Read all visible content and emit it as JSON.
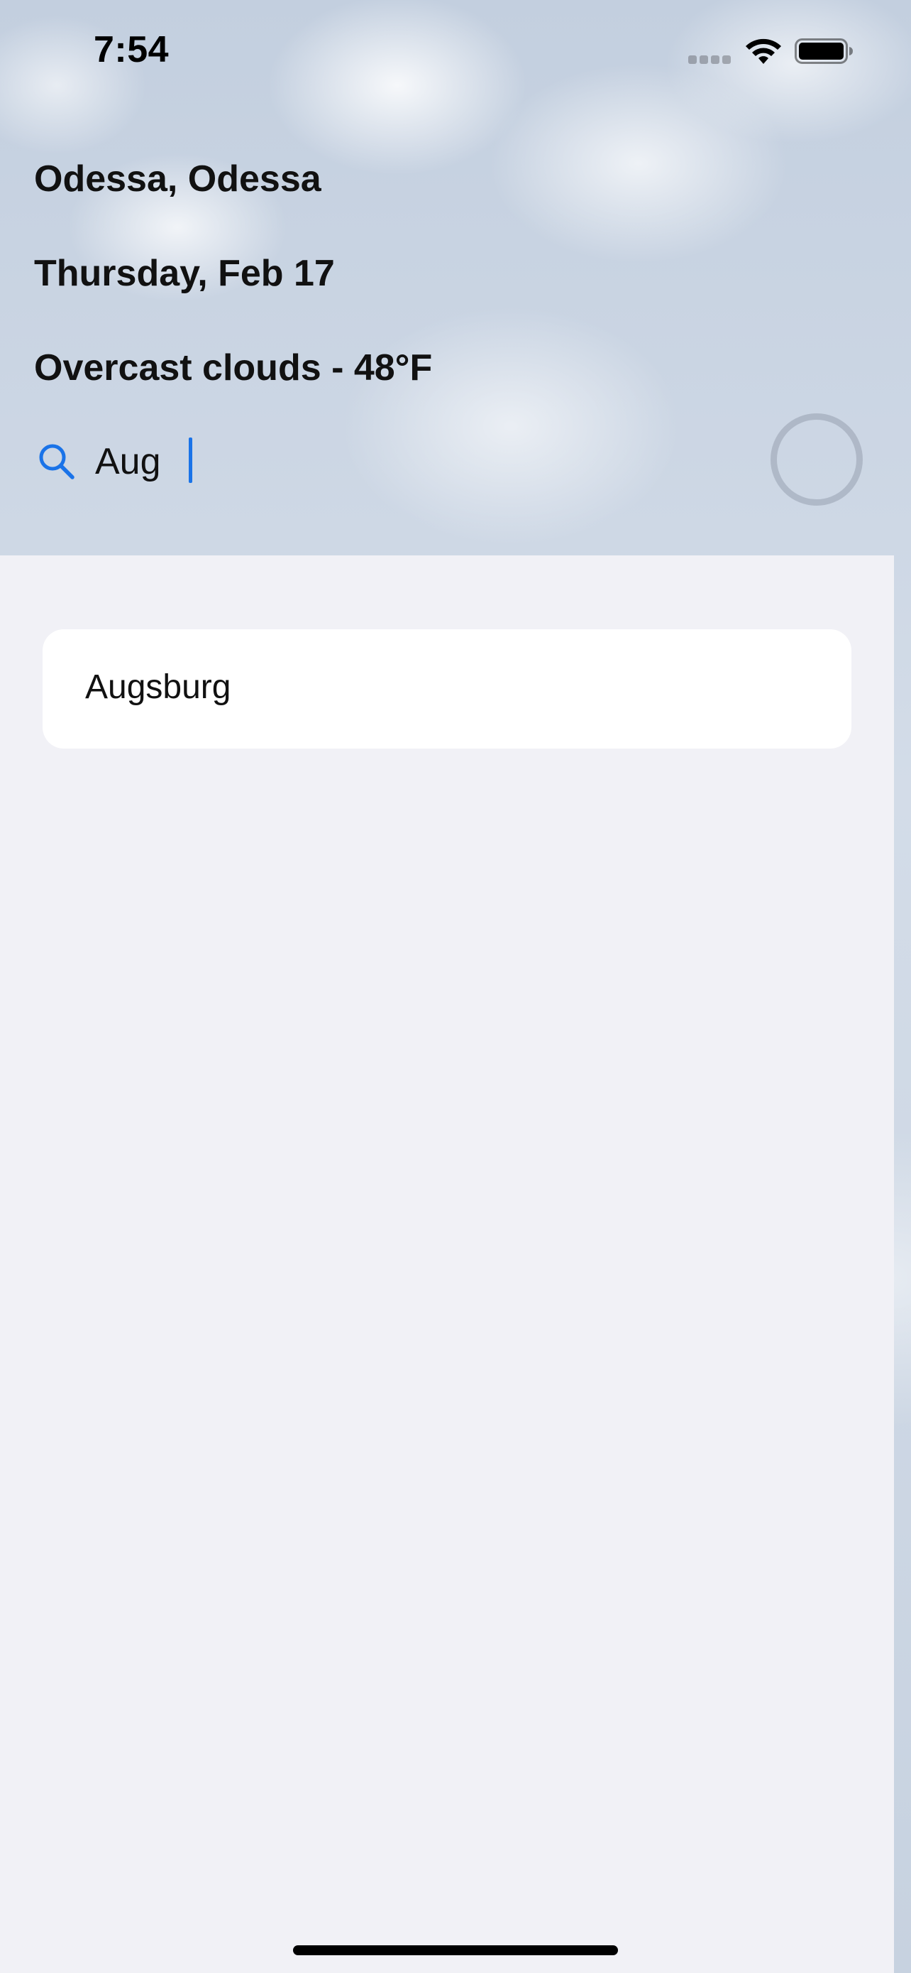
{
  "status_bar": {
    "time": "7:54",
    "icons": [
      "cellular-signal-icon",
      "wifi-icon",
      "battery-icon"
    ]
  },
  "header": {
    "location": "Odessa, Odessa",
    "date": "Thursday, Feb 17",
    "weather": "Overcast clouds - 48°F"
  },
  "search": {
    "icon": "search-icon",
    "value": "Aug",
    "accent_color": "#1a73e8"
  },
  "results": [
    {
      "label": "Augsburg"
    }
  ],
  "colors": {
    "panel_background": "#f1f1f6",
    "card_background": "#ffffff"
  }
}
